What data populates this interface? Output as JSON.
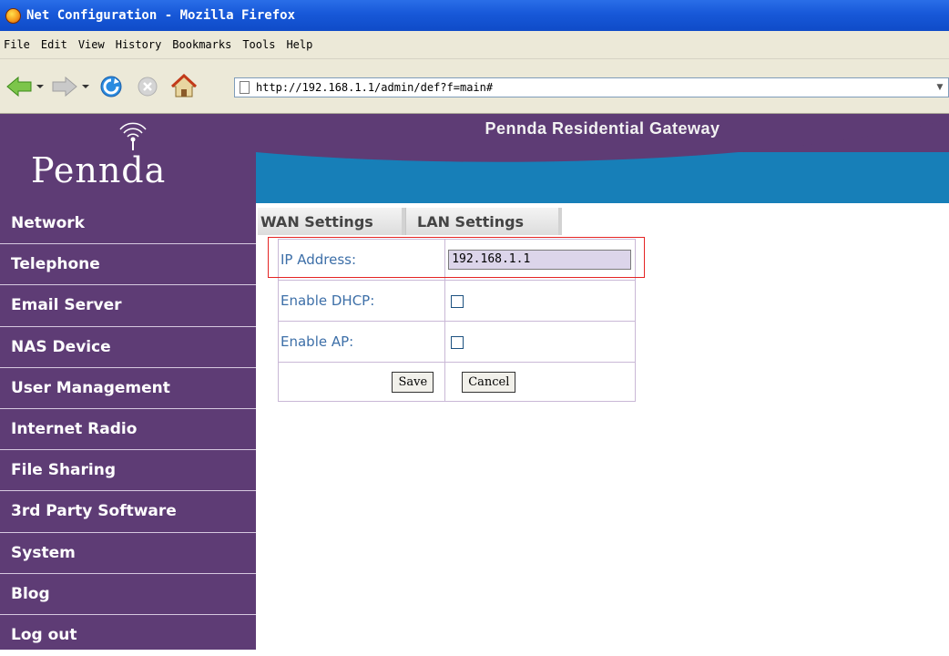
{
  "window": {
    "title": "Net Configuration - Mozilla Firefox",
    "icon": "firefox-icon"
  },
  "menu": {
    "items": [
      "File",
      "Edit",
      "View",
      "History",
      "Bookmarks",
      "Tools",
      "Help"
    ]
  },
  "toolbar": {
    "url": "http://192.168.1.1/admin/def?f=main#",
    "icons": [
      "back-icon",
      "forward-icon",
      "reload-icon",
      "stop-icon",
      "home-icon",
      "page-icon"
    ]
  },
  "header": {
    "logo": "Pennda",
    "title": "Pennda Residential Gateway"
  },
  "sidebar": {
    "items": [
      {
        "label": "Network"
      },
      {
        "label": "Telephone"
      },
      {
        "label": "Email Server"
      },
      {
        "label": "NAS Device"
      },
      {
        "label": "User Management"
      },
      {
        "label": "Internet Radio"
      },
      {
        "label": "File Sharing"
      },
      {
        "label": "3rd Party Software"
      },
      {
        "label": "System"
      },
      {
        "label": "Blog"
      },
      {
        "label": "Log out"
      }
    ]
  },
  "tabs": {
    "wan": "WAN Settings",
    "lan": "LAN Settings"
  },
  "form": {
    "ip_label": "IP Address:",
    "ip_value": "192.168.1.1",
    "dhcp_label": "Enable DHCP:",
    "dhcp_checked": false,
    "ap_label": "Enable AP:",
    "ap_checked": false,
    "save_label": "Save",
    "cancel_label": "Cancel"
  },
  "colors": {
    "sidebar_bg": "#5e3c75",
    "header_blue": "#177fb8",
    "highlight": "#e42424",
    "label_text": "#3d6fa8"
  }
}
